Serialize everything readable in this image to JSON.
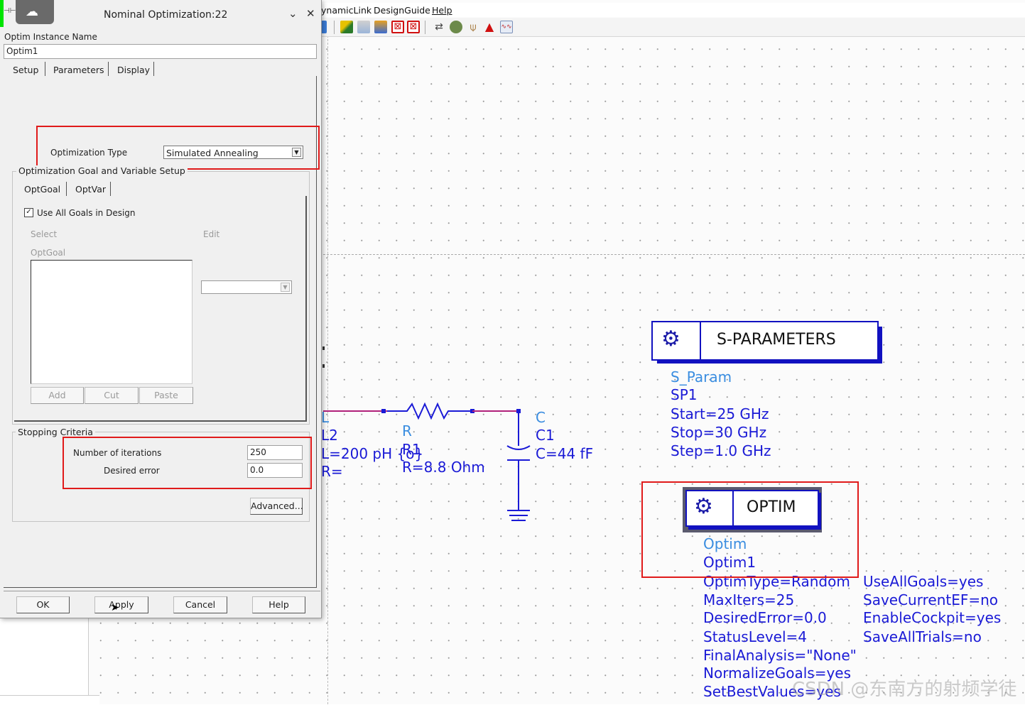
{
  "dialog": {
    "title": "Nominal Optimization:22",
    "instance_name_label": "Optim Instance Name",
    "instance_name_value": "Optim1",
    "tabs": [
      "Setup",
      "Parameters",
      "Display"
    ],
    "optimization_type_label": "Optimization Type",
    "optimization_type_value": "Simulated Annealing",
    "goal_group_label": "Optimization Goal and Variable Setup",
    "goal_tabs": [
      "OptGoal",
      "OptVar"
    ],
    "use_all_goals_label": "Use All Goals in Design",
    "use_all_goals_checked": true,
    "select_label": "Select",
    "edit_label": "Edit",
    "optgoal_list_label": "OptGoal",
    "list_buttons": [
      "Add",
      "Cut",
      "Paste"
    ],
    "stopping_group_label": "Stopping Criteria",
    "iterations_label": "Number of iterations",
    "iterations_value": "250",
    "desired_error_label": "Desired error",
    "desired_error_value": "0.0",
    "advanced_button": "Advanced...",
    "footer_buttons": [
      "OK",
      "Apply",
      "Cancel",
      "Help"
    ]
  },
  "menubar": [
    "ynamicLink",
    "DesignGuide",
    "Help"
  ],
  "schematic": {
    "inductor": {
      "type_label": "L",
      "name": "L2",
      "value": "L=200 pH {o}",
      "r_value": "R="
    },
    "resistor": {
      "type_label": "R",
      "name": "R1",
      "value": "R=8.8 Ohm"
    },
    "capacitor": {
      "type_label": "C",
      "name": "C1",
      "value": "C=44 fF"
    },
    "sparam": {
      "title": "S-PARAMETERS",
      "type": "S_Param",
      "name": "SP1",
      "params": [
        "Start=25 GHz",
        "Stop=30 GHz",
        "Step=1.0 GHz"
      ]
    },
    "optim": {
      "title": "OPTIM",
      "type": "Optim",
      "name": "Optim1",
      "params_left": [
        "OptimType=Random",
        "MaxIters=25",
        "DesiredError=0.0",
        "StatusLevel=4",
        "FinalAnalysis=\"None\"",
        "NormalizeGoals=yes",
        "SetBestValues=yes"
      ],
      "params_right": [
        "UseAllGoals=yes",
        "SaveCurrentEF=no",
        "EnableCockpit=yes",
        "SaveAllTrials=no"
      ]
    }
  },
  "watermark": "CSDN @东南方的射频学徒",
  "colors": {
    "highlight": "#e01a1a",
    "schematic_text": "#1a1ad6",
    "component_light": "#3a8de0",
    "wire_magenta": "#b0207a"
  }
}
